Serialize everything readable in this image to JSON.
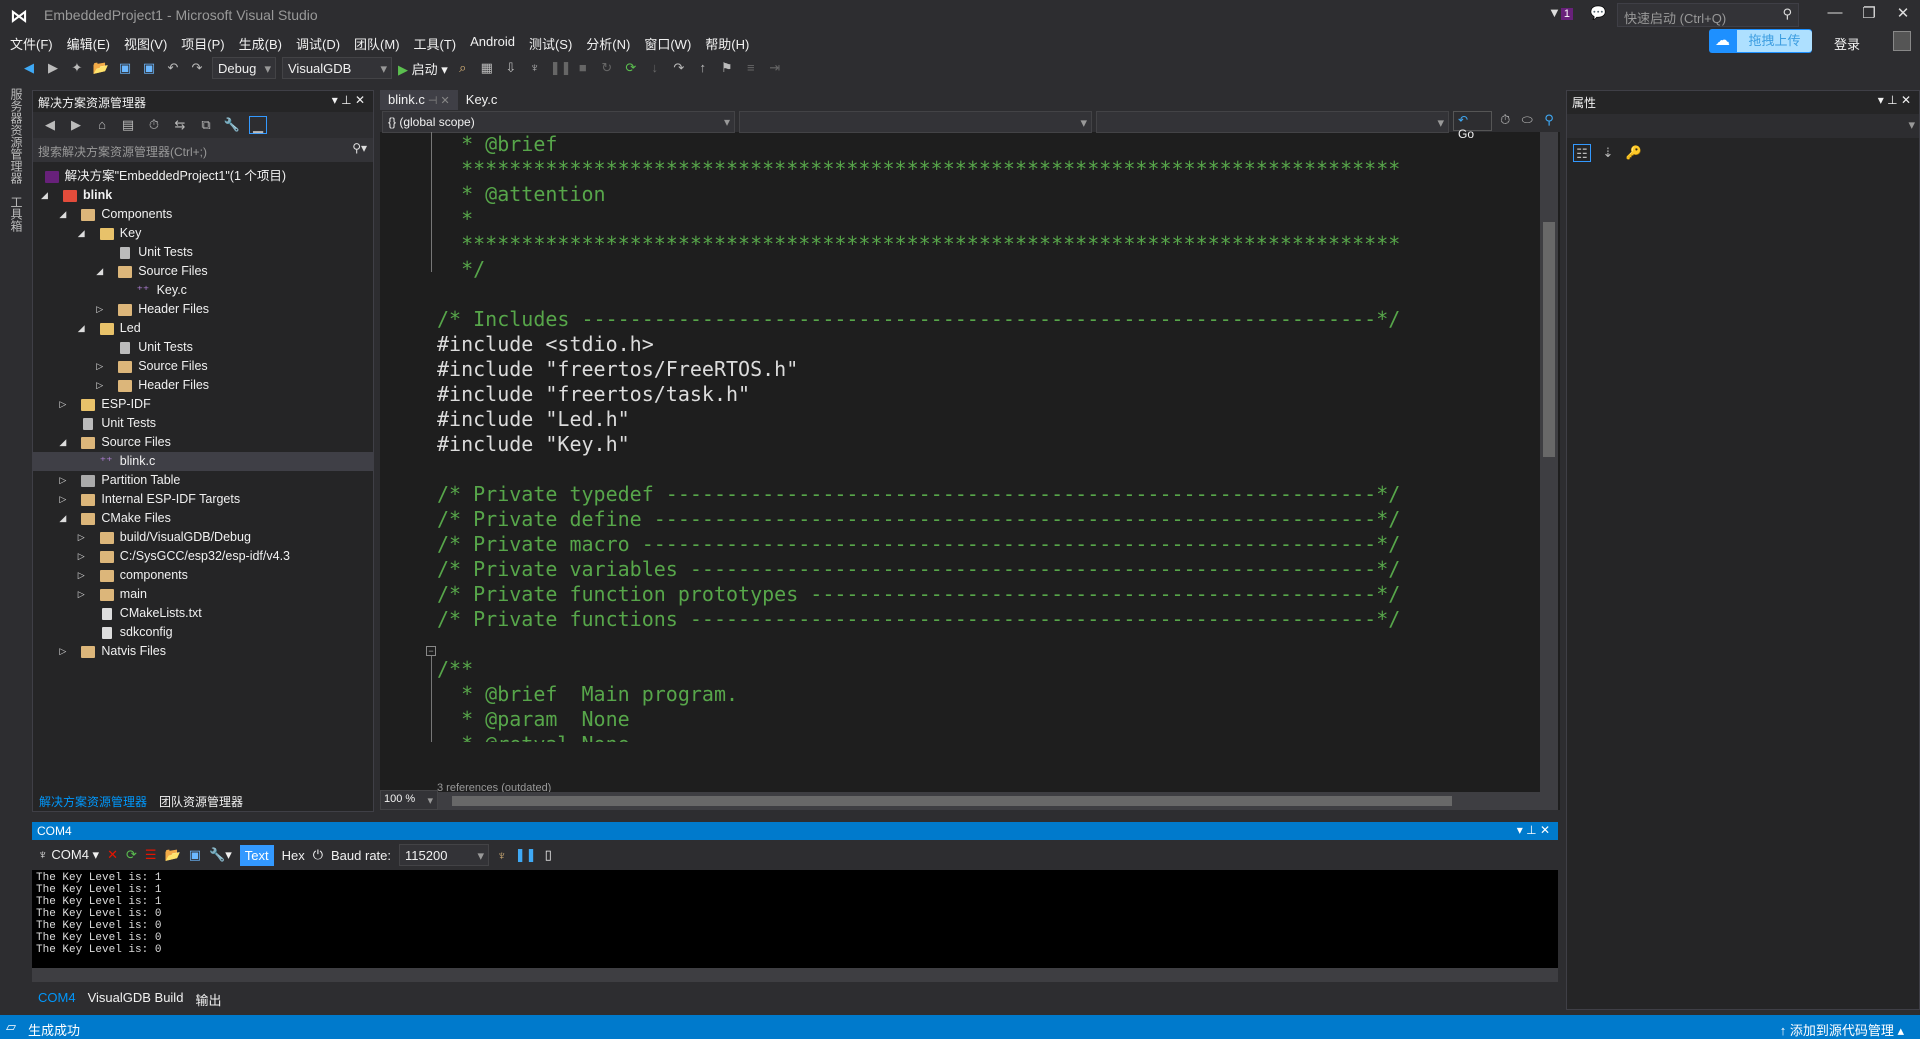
{
  "window": {
    "title": "EmbeddedProject1 - Microsoft Visual Studio",
    "quick_launch_placeholder": "快速启动 (Ctrl+Q)",
    "notification_count": "1",
    "upload_label": "拖拽上传",
    "login_label": "登录"
  },
  "menu": [
    "文件(F)",
    "编辑(E)",
    "视图(V)",
    "项目(P)",
    "生成(B)",
    "调试(D)",
    "团队(M)",
    "工具(T)",
    "Android",
    "测试(S)",
    "分析(N)",
    "窗口(W)",
    "帮助(H)"
  ],
  "toolbar": {
    "config": "Debug",
    "platform": "VisualGDB",
    "start_label": "启动"
  },
  "left_strip": [
    "服务器资源管理器",
    "工具箱"
  ],
  "solution_explorer": {
    "title": "解决方案资源管理器",
    "search_placeholder": "搜索解决方案资源管理器(Ctrl+;)",
    "items": [
      {
        "label": "解决方案\"EmbeddedProject1\"(1 个项目)",
        "level": -1,
        "expander": "none",
        "icon": "solution-icon"
      },
      {
        "label": "blink",
        "level": 0,
        "expander": "open",
        "icon": "project-icon",
        "bold": true
      },
      {
        "label": "Components",
        "level": 1,
        "expander": "open",
        "icon": "folder-icon"
      },
      {
        "label": "Key",
        "level": 2,
        "expander": "open",
        "icon": "package-icon"
      },
      {
        "label": "Unit Tests",
        "level": 3,
        "expander": "none",
        "icon": "flask-icon"
      },
      {
        "label": "Source Files",
        "level": 3,
        "expander": "open",
        "icon": "filter-folder-icon"
      },
      {
        "label": "Key.c",
        "level": 4,
        "expander": "none",
        "icon": "cpp-file-icon"
      },
      {
        "label": "Header Files",
        "level": 3,
        "expander": "closed",
        "icon": "filter-folder-icon"
      },
      {
        "label": "Led",
        "level": 2,
        "expander": "open",
        "icon": "package-icon"
      },
      {
        "label": "Unit Tests",
        "level": 3,
        "expander": "none",
        "icon": "flask-icon"
      },
      {
        "label": "Source Files",
        "level": 3,
        "expander": "closed",
        "icon": "filter-folder-icon"
      },
      {
        "label": "Header Files",
        "level": 3,
        "expander": "closed",
        "icon": "filter-folder-icon"
      },
      {
        "label": "ESP-IDF",
        "level": 1,
        "expander": "closed",
        "icon": "package-icon"
      },
      {
        "label": "Unit Tests",
        "level": 1,
        "expander": "none",
        "icon": "flask-icon"
      },
      {
        "label": "Source Files",
        "level": 1,
        "expander": "open",
        "icon": "filter-folder-icon"
      },
      {
        "label": "blink.c",
        "level": 2,
        "expander": "none",
        "icon": "cpp-file-icon",
        "selected": true
      },
      {
        "label": "Partition Table",
        "level": 1,
        "expander": "closed",
        "icon": "table-icon"
      },
      {
        "label": "Internal ESP-IDF Targets",
        "level": 1,
        "expander": "closed",
        "icon": "target-folder-icon"
      },
      {
        "label": "CMake Files",
        "level": 1,
        "expander": "open",
        "icon": "cmake-folder-icon"
      },
      {
        "label": "build/VisualGDB/Debug",
        "level": 2,
        "expander": "closed",
        "icon": "folder-icon"
      },
      {
        "label": "C:/SysGCC/esp32/esp-idf/v4.3",
        "level": 2,
        "expander": "closed",
        "icon": "folder-icon"
      },
      {
        "label": "components",
        "level": 2,
        "expander": "closed",
        "icon": "folder-icon"
      },
      {
        "label": "main",
        "level": 2,
        "expander": "closed",
        "icon": "folder-icon"
      },
      {
        "label": "CMakeLists.txt",
        "level": 2,
        "expander": "none",
        "icon": "cmake-file-icon"
      },
      {
        "label": "sdkconfig",
        "level": 2,
        "expander": "none",
        "icon": "cmake-file-icon"
      },
      {
        "label": "Natvis Files",
        "level": 1,
        "expander": "closed",
        "icon": "filter-folder-icon"
      }
    ],
    "bottom_tabs": [
      {
        "label": "解决方案资源管理器",
        "active": true
      },
      {
        "label": "团队资源管理器",
        "active": false
      }
    ]
  },
  "editor": {
    "tabs": [
      {
        "label": "blink.c",
        "active": true
      },
      {
        "label": "Key.c",
        "active": false
      }
    ],
    "scope": "{} (global scope)",
    "go_label": "Go",
    "zoom": "100 %",
    "references": "3 references (outdated)",
    "lines": [
      {
        "t": "  * @brief",
        "k": "comment"
      },
      {
        "t": "  ******************************************************************************",
        "k": "comment"
      },
      {
        "t": "  * @attention",
        "k": "comment"
      },
      {
        "t": "  *",
        "k": "comment"
      },
      {
        "t": "  ******************************************************************************",
        "k": "comment"
      },
      {
        "t": "  */",
        "k": "comment"
      },
      {
        "t": "",
        "k": "plain"
      },
      {
        "t": "/* Includes ------------------------------------------------------------------*/",
        "k": "comment"
      },
      {
        "t": "#include <stdio.h>",
        "k": "plain"
      },
      {
        "t": "#include \"freertos/FreeRTOS.h\"",
        "k": "plain"
      },
      {
        "t": "#include \"freertos/task.h\"",
        "k": "plain"
      },
      {
        "t": "#include \"Led.h\"",
        "k": "plain"
      },
      {
        "t": "#include \"Key.h\"",
        "k": "plain"
      },
      {
        "t": "",
        "k": "plain"
      },
      {
        "t": "/* Private typedef -----------------------------------------------------------*/",
        "k": "comment"
      },
      {
        "t": "/* Private define ------------------------------------------------------------*/",
        "k": "comment"
      },
      {
        "t": "/* Private macro -------------------------------------------------------------*/",
        "k": "comment"
      },
      {
        "t": "/* Private variables ---------------------------------------------------------*/",
        "k": "comment"
      },
      {
        "t": "/* Private function prototypes -----------------------------------------------*/",
        "k": "comment"
      },
      {
        "t": "/* Private functions ---------------------------------------------------------*/",
        "k": "comment"
      },
      {
        "t": "",
        "k": "plain"
      },
      {
        "t": "/**",
        "k": "comment"
      },
      {
        "t": "  * @brief  Main program.",
        "k": "comment"
      },
      {
        "t": "  * @param  None",
        "k": "comment"
      },
      {
        "t": "  * @retval None",
        "k": "comment"
      },
      {
        "t": "  */",
        "k": "comment"
      }
    ]
  },
  "properties": {
    "title": "属性"
  },
  "serial": {
    "title": "COM4",
    "port": "COM4",
    "text_mode": "Text",
    "hex_mode": "Hex",
    "baud_label": "Baud rate:",
    "baud": "115200",
    "output": [
      "The Key Level is: 1",
      "The Key Level is: 1",
      "The Key Level is: 1",
      "The Key Level is: 0",
      "The Key Level is: 0",
      "The Key Level is: 0",
      "The Key Level is: 0"
    ],
    "tabs": [
      {
        "label": "COM4",
        "active": true
      },
      {
        "label": "VisualGDB Build",
        "active": false
      },
      {
        "label": "输出",
        "active": false
      }
    ]
  },
  "status": {
    "message": "生成成功",
    "source_control": "添加到源代码管理"
  },
  "colors": {
    "accent": "#007ACC",
    "comment": "#57A64A",
    "background": "#2D2D30",
    "editor": "#1E1E1E"
  }
}
